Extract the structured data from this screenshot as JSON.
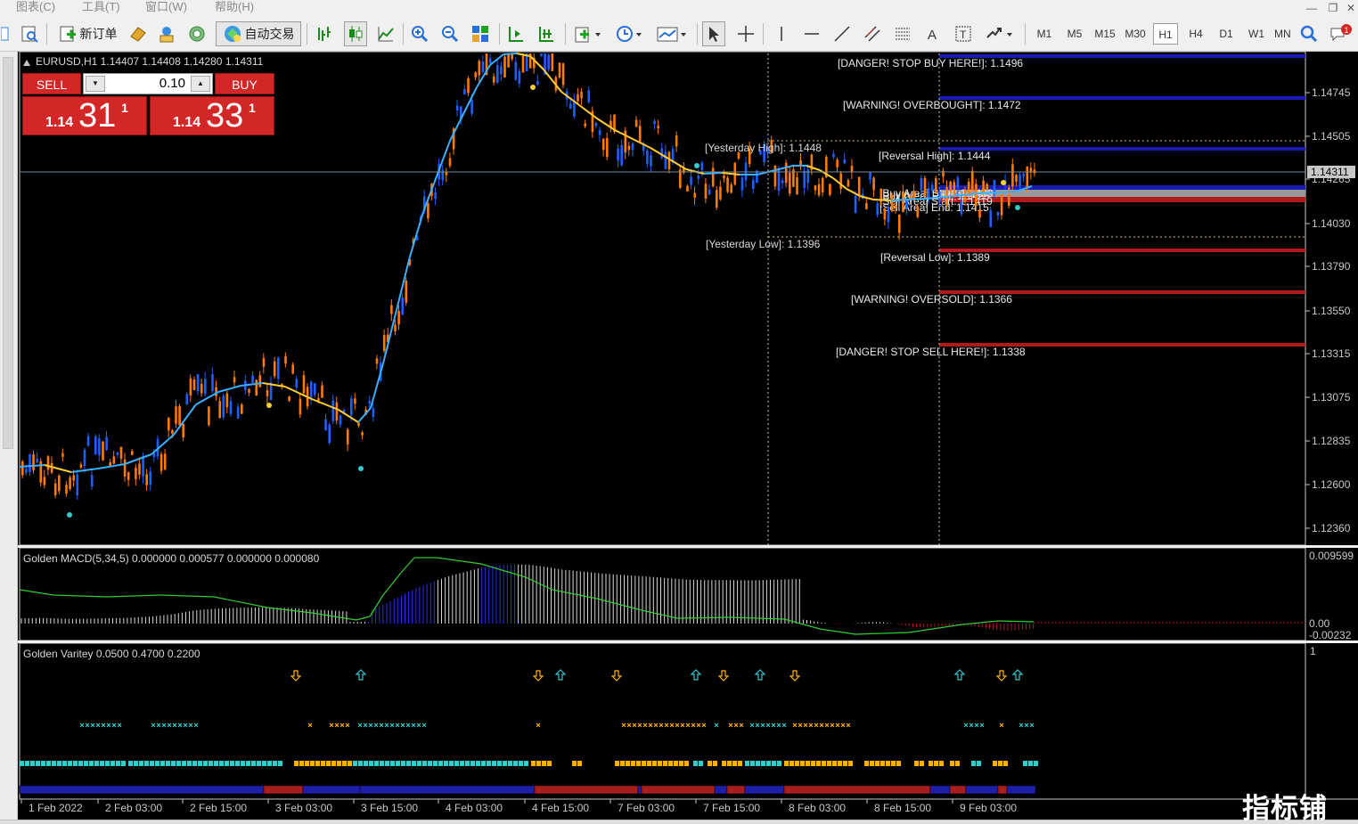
{
  "menu": [
    "图表(C)",
    "工具(T)",
    "窗口(W)",
    "帮助(H)"
  ],
  "toolbar": {
    "new_order": "新订单",
    "auto_trading": "自动交易"
  },
  "timeframes": [
    "M1",
    "M5",
    "M15",
    "M30",
    "H1",
    "H4",
    "D1",
    "W1",
    "MN"
  ],
  "active_timeframe": "H1",
  "chart": {
    "header": "EURUSD,H1  1.14407 1.14408 1.14280 1.14311",
    "current_price": "1.14311",
    "price_ticks": [
      "1.14745",
      "1.14505",
      "1.14265",
      "1.14030",
      "1.13790",
      "1.13550",
      "1.13315",
      "1.13075",
      "1.12835",
      "1.12600",
      "1.12360"
    ],
    "time_labels": [
      "1 Feb 2022",
      "2 Feb 03:00",
      "2 Feb 15:00",
      "3 Feb 03:00",
      "3 Feb 15:00",
      "4 Feb 03:00",
      "4 Feb 15:00",
      "7 Feb 03:00",
      "7 Feb 15:00",
      "8 Feb 03:00",
      "8 Feb 15:00",
      "9 Feb 03:00"
    ],
    "levels": [
      {
        "label": "[DANGER! STOP BUY HERE!]: 1.1496",
        "color": "#1a1ab0"
      },
      {
        "label": "[WARNING! OVERBOUGHT]: 1.1472",
        "color": "#1a1ab0"
      },
      {
        "label": "[Reversal High]: 1.1444",
        "color": "#1a1ab0"
      },
      {
        "label": "[Reversal Low]: 1.1389",
        "color": "#b01a1a"
      },
      {
        "label": "[WARNING! OVERSOLD]: 1.1366",
        "color": "#b01a1a"
      },
      {
        "label": "[DANGER! STOP SELL HERE!]: 1.1338",
        "color": "#b01a1a"
      }
    ],
    "yesterday_high": "[Yesterday High]: 1.1448",
    "yesterday_low": "[Yesterday Low]: 1.1396",
    "area_labels": [
      "[Buy Area] Start: 1.1429",
      "[Buy Area] End: 1.1425",
      "[Sell Area] Start: 1.1419",
      "[Sell Area] End: 1.1415"
    ]
  },
  "trade_panel": {
    "sell_label": "SELL",
    "buy_label": "BUY",
    "lot": "0.10",
    "bid_small": "1.14",
    "bid_big": "31",
    "bid_sup": "1",
    "ask_small": "1.14",
    "ask_big": "33",
    "ask_sup": "1"
  },
  "macd": {
    "header": "Golden MACD(5,34,5) 0.000000 0.000577 0.000000 0.000080",
    "ticks": [
      "0.009599",
      "0.00",
      "-0.00232"
    ]
  },
  "variety": {
    "header": "Golden Varitey 0.0500 0.4700 0.2200",
    "ticks": [
      "1"
    ]
  },
  "watermark": "指标铺",
  "colors": {
    "bull": "#1e5fff",
    "bear": "#ff7b00",
    "ma_up": "#39b0ff",
    "ma_down": "#ffcc33",
    "macd_line": "#33cc33",
    "up_arrow": "#33cccc",
    "down_arrow": "#ffb000"
  }
}
